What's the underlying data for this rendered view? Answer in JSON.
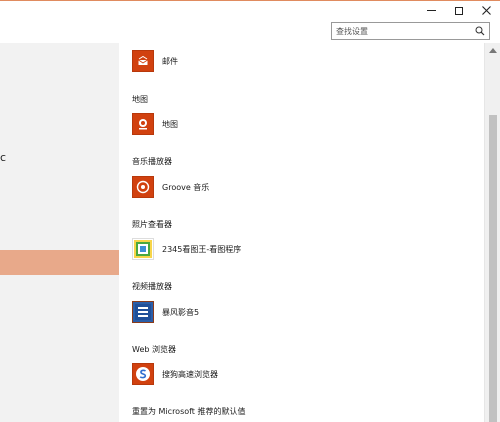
{
  "search": {
    "placeholder": "查找设置"
  },
  "sections": [
    {
      "label": "",
      "app": "邮件",
      "icon": "mail-icon"
    },
    {
      "label": "地图",
      "app": "地图",
      "icon": "map-icon"
    },
    {
      "label": "音乐播放器",
      "app": "Groove 音乐",
      "icon": "groove-music-icon"
    },
    {
      "label": "照片查看器",
      "app": "2345看图王-看图程序",
      "icon": "photo-viewer-icon"
    },
    {
      "label": "视频播放器",
      "app": "暴风影音5",
      "icon": "video-player-icon"
    },
    {
      "label": "Web 浏览器",
      "app": "搜狗高速浏览器",
      "icon": "sogou-browser-icon"
    }
  ],
  "reset_label": "重置为 Microsoft 推荐的默认值",
  "left_fragment": "c",
  "colors": {
    "accent": "#d1410f",
    "selected_nav": "#e8a98a",
    "titlebar_border": "#e08b5f"
  }
}
